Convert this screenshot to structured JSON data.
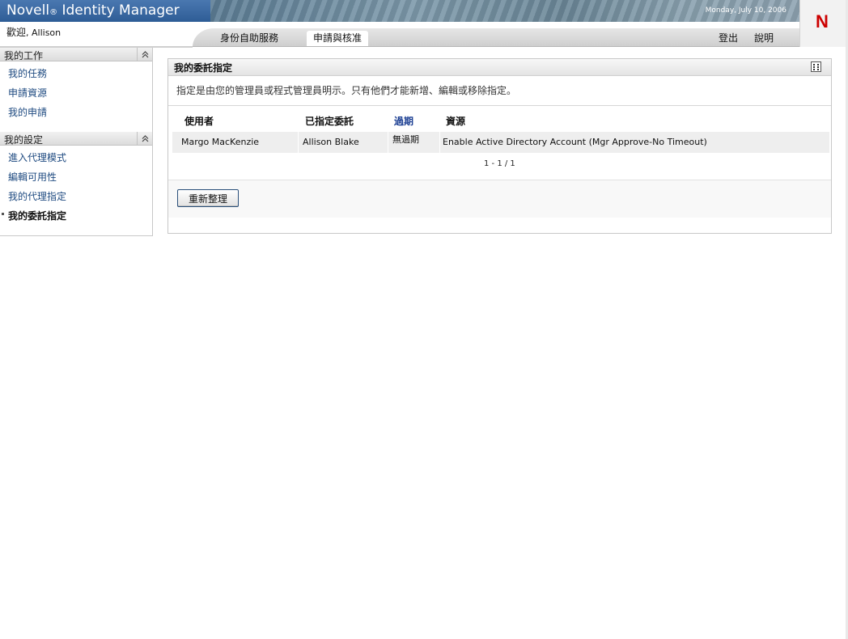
{
  "header": {
    "brand": "Novell",
    "brand_reg": "®",
    "brand_product": " Identity Manager",
    "date": "Monday, July 10, 2006",
    "logo_letter": "N",
    "welcome_label": "歡迎",
    "welcome_user": ", Allison",
    "tabs": [
      {
        "label": "身份自助服務",
        "active": false
      },
      {
        "label": "申請與核准",
        "active": true
      }
    ],
    "links": {
      "logout": "登出",
      "help": "說明"
    }
  },
  "sidebar": {
    "sections": [
      {
        "title": "我的工作",
        "items": [
          {
            "label": "我的任務"
          },
          {
            "label": "申請資源"
          },
          {
            "label": "我的申請"
          }
        ]
      },
      {
        "title": "我的設定",
        "items": [
          {
            "label": "進入代理模式"
          },
          {
            "label": "編輯可用性"
          },
          {
            "label": "我的代理指定"
          },
          {
            "label": "我的委託指定",
            "current": true
          }
        ]
      }
    ]
  },
  "portlet": {
    "title": "我的委託指定",
    "description": "指定是由您的管理員或程式管理員明示。只有他們才能新增、編輯或移除指定。",
    "columns": {
      "user": "使用者",
      "delegate": "已指定委託",
      "expiry": "過期",
      "resource": "資源"
    },
    "rows": [
      {
        "user": "Margo MacKenzie",
        "delegate": "Allison Blake",
        "expiry": "無過期",
        "resource": "Enable Active Directory Account (Mgr Approve-No Timeout)"
      }
    ],
    "pager": "1 - 1 / 1",
    "refresh_label": "重新整理"
  },
  "colors": {
    "accent": "#2e5d96",
    "link": "#1e4a80",
    "logo": "#cc0000"
  }
}
